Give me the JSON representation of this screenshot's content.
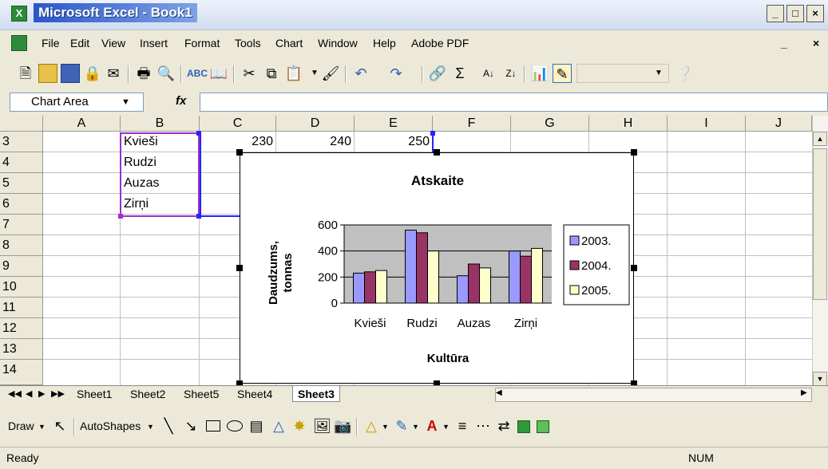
{
  "window": {
    "title": "Microsoft Excel - Book1",
    "buttons": [
      "_",
      "□",
      "×"
    ]
  },
  "menu": [
    "File",
    "Edit",
    "View",
    "Insert",
    "Format",
    "Tools",
    "Chart",
    "Window",
    "Help",
    "Adobe PDF"
  ],
  "menu_controls": [
    "_",
    "×"
  ],
  "formula_bar": {
    "name_box": "Chart Area",
    "fx": "fx",
    "value": ""
  },
  "columns": [
    "A",
    "B",
    "C",
    "D",
    "E",
    "F",
    "G",
    "H",
    "I",
    "J"
  ],
  "rows": [
    "3",
    "4",
    "5",
    "6",
    "7",
    "8",
    "9",
    "10",
    "11",
    "12",
    "13",
    "14"
  ],
  "cells": {
    "B3": "Kvieši",
    "B4": "Rudzi",
    "B5": "Auzas",
    "B6": "Zirņi",
    "C3": "230",
    "D3": "240",
    "E3": "250"
  },
  "sheet_tabs": [
    "Sheet1",
    "Sheet2",
    "Sheet5",
    "Sheet4",
    "Sheet3"
  ],
  "active_sheet": "Sheet3",
  "draw_toolbar": {
    "draw_label": "Draw",
    "autoshapes_label": "AutoShapes"
  },
  "status": {
    "ready": "Ready",
    "num": "NUM"
  },
  "colors": {
    "series_2003": "#9999FF",
    "series_2004": "#993366",
    "series_2005": "#FFFFCC",
    "plot_area": "#C0C0C0"
  },
  "chart_data": {
    "type": "bar",
    "title": "Atskaite",
    "xlabel": "Kultūra",
    "ylabel": "Daudzums, tonnas",
    "categories": [
      "Kvieši",
      "Rudzi",
      "Auzas",
      "Zirņi"
    ],
    "series": [
      {
        "name": "2003.",
        "values": [
          230,
          560,
          210,
          400
        ]
      },
      {
        "name": "2004.",
        "values": [
          240,
          540,
          300,
          360
        ]
      },
      {
        "name": "2005.",
        "values": [
          250,
          400,
          270,
          420
        ]
      }
    ],
    "yticks": [
      "0",
      "200",
      "400",
      "600"
    ],
    "ylim": [
      0,
      600
    ],
    "grid": true,
    "legend": "right"
  }
}
